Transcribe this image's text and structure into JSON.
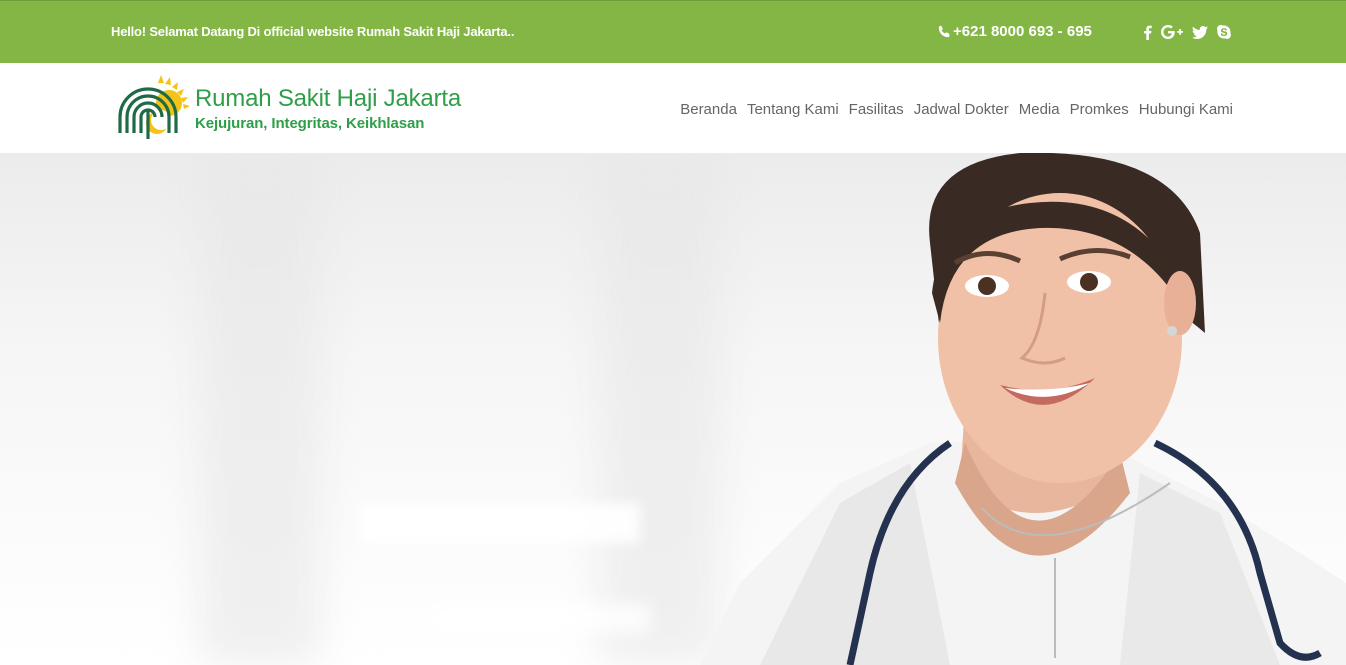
{
  "topbar": {
    "greeting": "Hello! Selamat Datang Di official website Rumah Sakit Haji Jakarta..",
    "phone": "+621 8000 693 - 695",
    "social": [
      {
        "name": "facebook-icon",
        "glyph": "f"
      },
      {
        "name": "google-plus-icon",
        "glyph": "G+"
      },
      {
        "name": "twitter-icon",
        "glyph": ""
      },
      {
        "name": "skype-icon",
        "glyph": ""
      }
    ]
  },
  "brand": {
    "title": "Rumah Sakit Haji Jakarta",
    "tagline": "Kejujuran, Integritas, Keikhlasan"
  },
  "nav": {
    "items": [
      "Beranda",
      "Tentang Kami",
      "Fasilitas",
      "Jadwal Dokter",
      "Media",
      "Promkes",
      "Hubungi Kami"
    ]
  },
  "colors": {
    "topbar": "#83b644",
    "brand_green": "#2f9e48",
    "logo_dark_green": "#1e6b46",
    "logo_yellow": "#f3c317",
    "nav_text": "#666666"
  }
}
